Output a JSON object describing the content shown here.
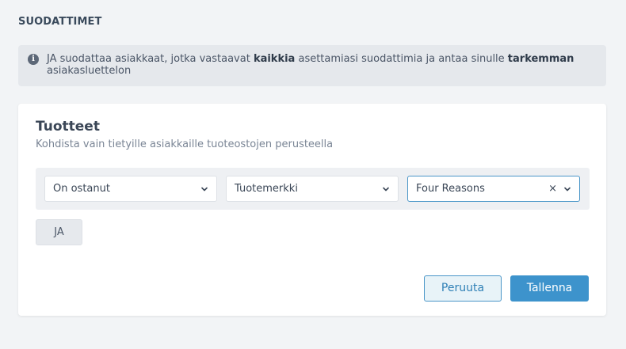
{
  "section": {
    "title": "SUODATTIMET"
  },
  "info": {
    "text_1": "JA suodattaa asiakkaat, jotka vastaavat ",
    "bold_1": "kaikkia",
    "text_2": " asettamiasi suodattimia ja antaa sinulle ",
    "bold_2": "tarkemman",
    "text_3": " asiakasluettelon"
  },
  "card": {
    "title": "Tuotteet",
    "subtitle": "Kohdista vain tietyille asiakkaille tuoteostojen perusteella"
  },
  "filters": {
    "condition": "On ostanut",
    "attribute": "Tuotemerkki",
    "value": "Four Reasons",
    "clear": "×"
  },
  "buttons": {
    "and": "JA",
    "cancel": "Peruuta",
    "save": "Tallenna"
  },
  "colors": {
    "accent": "#3d93cc",
    "background": "#f2f4f6"
  }
}
